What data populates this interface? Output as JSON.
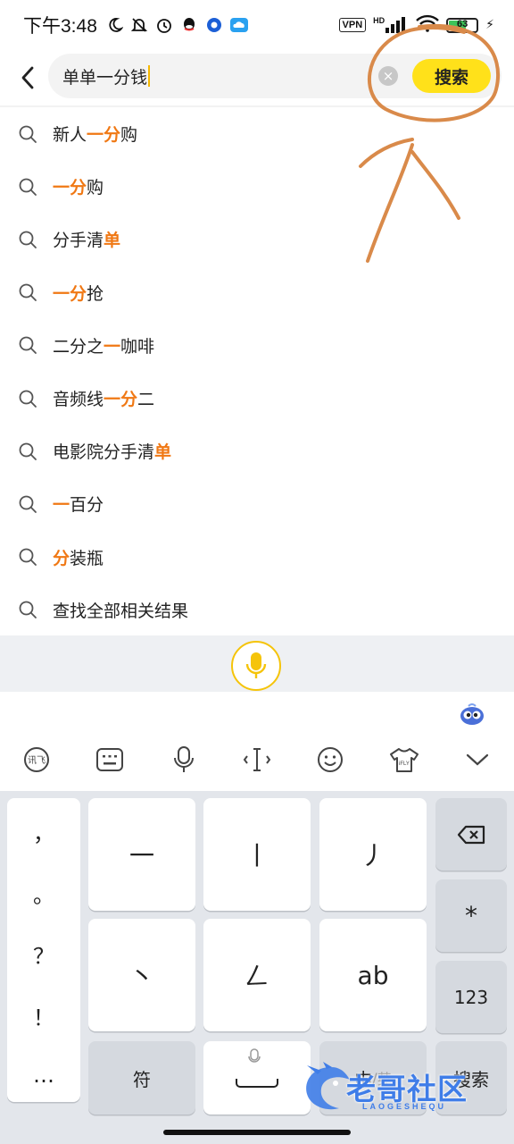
{
  "status_bar": {
    "time": "下午3:48",
    "vpn": "VPN",
    "network": "HD",
    "battery": "63",
    "battery_level": 0.63
  },
  "search": {
    "query": "单单一分钱",
    "button": "搜索"
  },
  "suggestions": [
    {
      "parts": [
        {
          "t": "新人",
          "h": false
        },
        {
          "t": "一分",
          "h": true
        },
        {
          "t": "购",
          "h": false
        }
      ]
    },
    {
      "parts": [
        {
          "t": "一分",
          "h": true
        },
        {
          "t": "购",
          "h": false
        }
      ]
    },
    {
      "parts": [
        {
          "t": "分手清",
          "h": false
        },
        {
          "t": "单",
          "h": true
        }
      ]
    },
    {
      "parts": [
        {
          "t": "一分",
          "h": true
        },
        {
          "t": "抢",
          "h": false
        }
      ]
    },
    {
      "parts": [
        {
          "t": "二分之",
          "h": false
        },
        {
          "t": "一",
          "h": true
        },
        {
          "t": "咖啡",
          "h": false
        }
      ]
    },
    {
      "parts": [
        {
          "t": "音频线",
          "h": false
        },
        {
          "t": "一分",
          "h": true
        },
        {
          "t": "二",
          "h": false
        }
      ]
    },
    {
      "parts": [
        {
          "t": "电影院分手清",
          "h": false
        },
        {
          "t": "单",
          "h": true
        }
      ]
    },
    {
      "parts": [
        {
          "t": "一",
          "h": true
        },
        {
          "t": "百分",
          "h": false
        }
      ]
    },
    {
      "parts": [
        {
          "t": "分",
          "h": true
        },
        {
          "t": "装瓶",
          "h": false
        }
      ]
    },
    {
      "parts": [
        {
          "t": "查找全部相关结果",
          "h": false
        }
      ]
    }
  ],
  "keyboard": {
    "punctuation": [
      "，",
      "。",
      "？",
      "！",
      "…"
    ],
    "stroke_keys": [
      "一",
      "丨",
      "丿",
      "丶",
      "𠃋",
      "ab"
    ],
    "star": "*",
    "num_key": "123",
    "symbol_key": "符",
    "lang_zh": "中",
    "lang_sep": "/",
    "lang_en": "英",
    "enter_key": "搜索"
  },
  "watermark": {
    "text": "老哥社区",
    "sub": "LAOGESHEQU"
  },
  "colors": {
    "highlight": "#f07814",
    "search_button": "#ffe11a",
    "annotation": "#d98a4a",
    "watermark": "#3f7de8"
  },
  "icons": {
    "status": [
      "moon-icon",
      "bell-off-icon",
      "alarm-icon",
      "qq-icon",
      "app-icon",
      "cloud-icon",
      "signal-icon",
      "wifi-icon",
      "battery-icon",
      "charging-icon"
    ],
    "toolbar": [
      "ifly-logo-icon",
      "keyboard-icon",
      "microphone-icon",
      "cursor-icon",
      "emoji-icon",
      "skin-icon",
      "collapse-icon"
    ]
  }
}
